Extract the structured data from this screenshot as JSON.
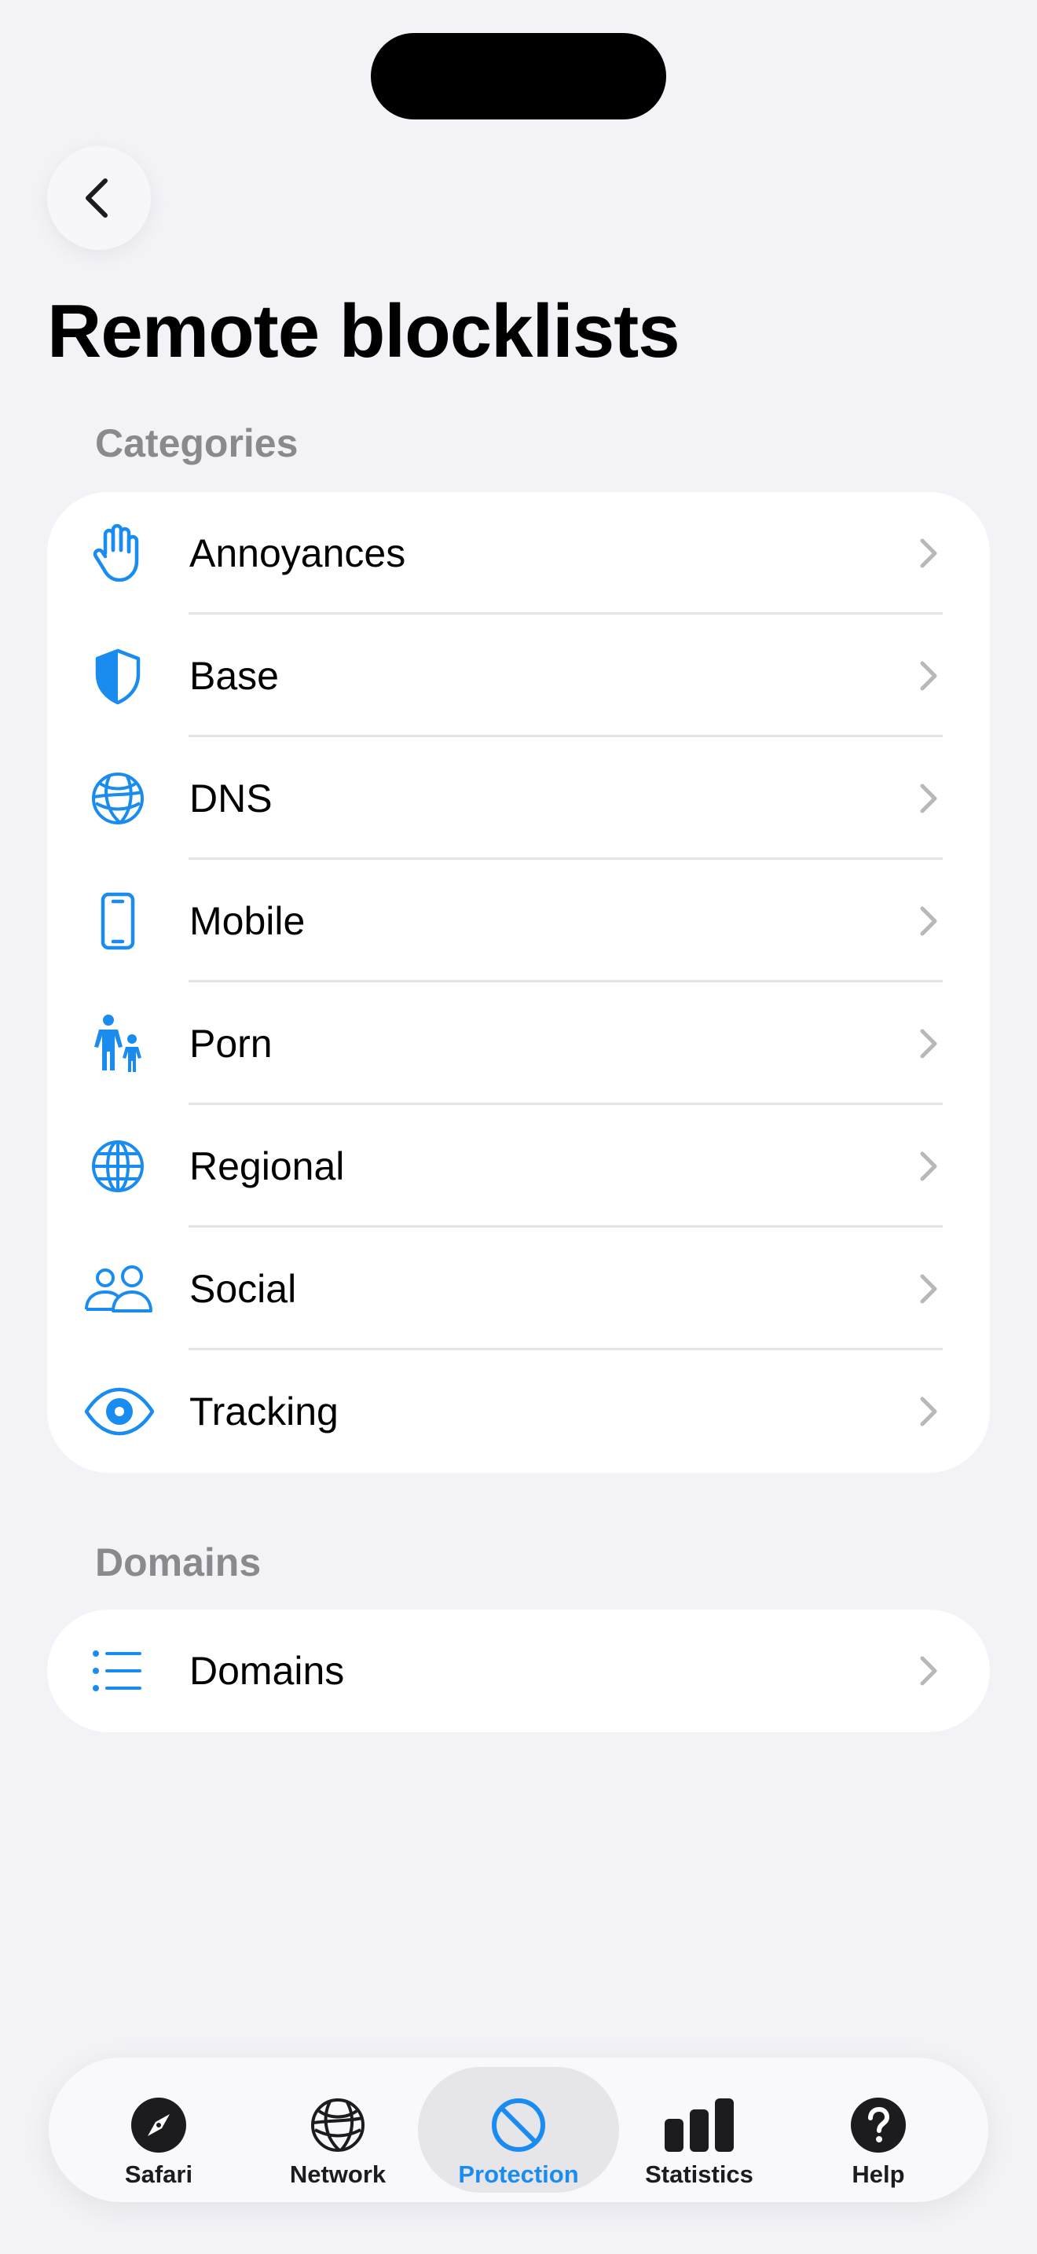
{
  "colors": {
    "accent": "#1a8cf0",
    "background": "#f2f2f7",
    "card": "#ffffff",
    "secondary_text": "#8a8a8e",
    "chevron": "#b8b8bc"
  },
  "nav": {
    "back_icon": "chevron-left-icon"
  },
  "title": "Remote blocklists",
  "categories": {
    "header": "Categories",
    "items": [
      {
        "label": "Annoyances",
        "icon": "hand-raised-icon"
      },
      {
        "label": "Base",
        "icon": "shield-half-icon"
      },
      {
        "label": "DNS",
        "icon": "network-globe-icon"
      },
      {
        "label": "Mobile",
        "icon": "iphone-icon"
      },
      {
        "label": "Porn",
        "icon": "figure-and-child-icon"
      },
      {
        "label": "Regional",
        "icon": "globe-icon"
      },
      {
        "label": "Social",
        "icon": "person-2-icon"
      },
      {
        "label": "Tracking",
        "icon": "eye-icon"
      }
    ]
  },
  "domains": {
    "header": "Domains",
    "items": [
      {
        "label": "Domains",
        "icon": "list-bullet-icon"
      }
    ]
  },
  "tabbar": {
    "tabs": [
      {
        "label": "Safari",
        "icon": "safari-compass-icon",
        "active": false
      },
      {
        "label": "Network",
        "icon": "network-globe-icon",
        "active": false
      },
      {
        "label": "Protection",
        "icon": "prohibited-icon",
        "active": true
      },
      {
        "label": "Statistics",
        "icon": "bar-chart-icon",
        "active": false
      },
      {
        "label": "Help",
        "icon": "question-circle-icon",
        "active": false
      }
    ]
  }
}
